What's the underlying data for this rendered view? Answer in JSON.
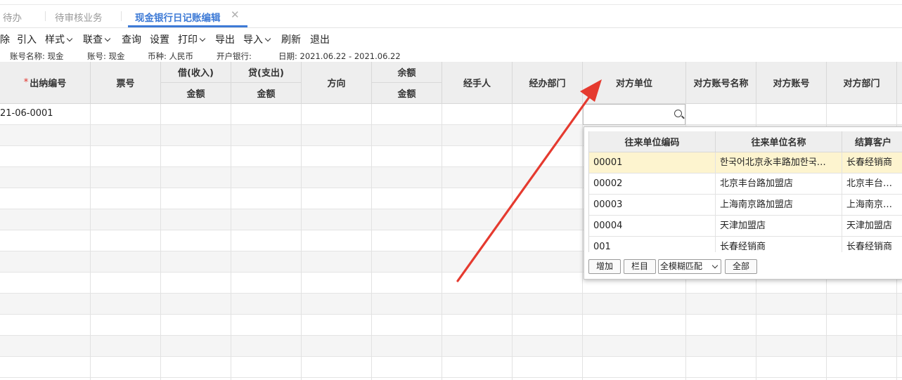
{
  "tabs": [
    {
      "label": "待办"
    },
    {
      "label": "待审核业务"
    },
    {
      "label": "现金银行日记账编辑",
      "active": true
    }
  ],
  "toolbar": {
    "delete": "除",
    "import_in": "引入",
    "style": "样式",
    "link_query": "联查",
    "query": "查询",
    "settings": "设置",
    "print": "打印",
    "export": "导出",
    "import": "导入",
    "refresh": "刷新",
    "exit": "退出"
  },
  "info": {
    "account_name": "账号名称: 现金",
    "account_no": "账号: 现金",
    "currency": "币种: 人民币",
    "bank": "开户银行:",
    "date": "日期: 2021.06.22 - 2021.06.22"
  },
  "grid": {
    "required_mark": "*",
    "columns": {
      "cashier_no": "出纳编号",
      "ticket_no": "票号",
      "debit": "借(收入)",
      "debit_amount": "金额",
      "credit": "贷(支出)",
      "credit_amount": "金额",
      "direction": "方向",
      "balance": "余额",
      "balance_amount": "金额",
      "handler": "经手人",
      "dept": "经办部门",
      "counter_unit": "对方单位",
      "counter_account_name": "对方账号名称",
      "counter_account": "对方账号",
      "counter_dept": "对方部门"
    },
    "rows": [
      {
        "cashier_no": "21-06-0001"
      }
    ]
  },
  "popup": {
    "headers": [
      "往来单位编码",
      "往来单位名称",
      "结算客户"
    ],
    "rows": [
      [
        "00001",
        "한국어北京永丰路加한국…",
        "长春经销商"
      ],
      [
        "00002",
        "北京丰台路加盟店",
        "北京丰台…"
      ],
      [
        "00003",
        "上海南京路加盟店",
        "上海南京…"
      ],
      [
        "00004",
        "天津加盟店",
        "天津加盟店"
      ],
      [
        "001",
        "长春经销商",
        "长春经销商"
      ]
    ],
    "add_button": "增加",
    "columns_button": "栏目",
    "match_select": "全模糊匹配",
    "all_button": "全部"
  },
  "colors": {
    "accent": "#3d7ad6",
    "arrow": "#e53a2f",
    "selected_row": "#fdf4cf"
  }
}
